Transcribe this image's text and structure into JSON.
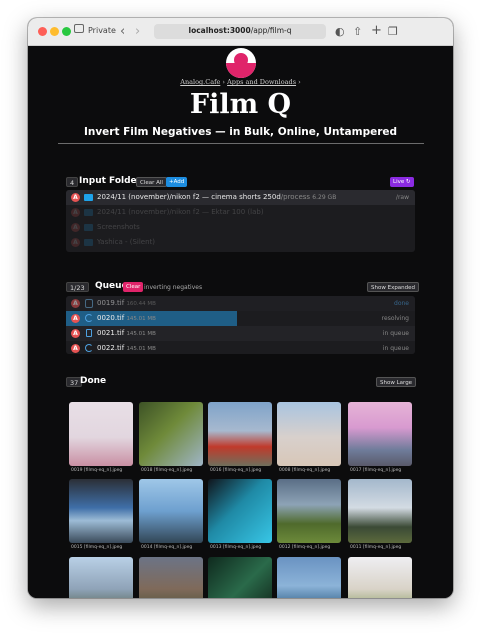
{
  "browser": {
    "private_label": "Private",
    "url_host": "localhost:3000",
    "url_path": "/app/film-q"
  },
  "header": {
    "breadcrumb_home": "Analog.Cafe",
    "breadcrumb_sep": "›",
    "breadcrumb_section": "Apps and Downloads",
    "title": "Film Q",
    "subtitle": "Invert Film Negatives — in Bulk, Online, Untampered"
  },
  "input_folders": {
    "count": "4",
    "title": "Input Folders",
    "clear_all_label": "Clear All",
    "add_label": "+Add",
    "live_label": "Live ↻",
    "rows": [
      {
        "name": "2024/11 (november)/nikon f2 — cinema shorts 250d",
        "path": "/process",
        "size": "6.29 GB",
        "status": "/raw",
        "dim": false
      },
      {
        "name": "2024/11 (november)/nikon f2 — Ektar 100 (lab)",
        "path": "",
        "size": "",
        "status": "",
        "dim": true
      },
      {
        "name": "Screenshots",
        "path": "",
        "size": "",
        "status": "",
        "dim": true
      },
      {
        "name": "Yashica - (Silent)",
        "path": "",
        "size": "",
        "status": "",
        "dim": true
      }
    ]
  },
  "queue": {
    "count": "1/23",
    "title": "Queue",
    "clear_label": "Clear",
    "status": "inverting negatives",
    "show_expanded_label": "Show Expanded",
    "rows": [
      {
        "name": "0019.tif",
        "size": "160.44 MB",
        "status": "done",
        "icon": "check",
        "progress": 0
      },
      {
        "name": "0020.tif",
        "size": "145.01 MB",
        "status": "resolving",
        "icon": "spin",
        "progress": 0.49
      },
      {
        "name": "0021.tif",
        "size": "145.01 MB",
        "status": "in queue",
        "icon": "file",
        "progress": 0
      },
      {
        "name": "0022.tif",
        "size": "145.01 MB",
        "status": "in queue",
        "icon": "spin",
        "progress": 0
      }
    ]
  },
  "done": {
    "count": "37",
    "title": "Done",
    "show_large_label": "Show Large",
    "items": [
      {
        "label": "0019 [filmq-eq_n].jpeg"
      },
      {
        "label": "0018 [filmq-eq_n].jpeg"
      },
      {
        "label": "0016 [filmq-eq_n].jpeg"
      },
      {
        "label": "0008 [filmq-eq_n].jpeg"
      },
      {
        "label": "0017 [filmq-eq_n].jpeg"
      },
      {
        "label": "0015 [filmq-eq_n].jpeg"
      },
      {
        "label": "0014 [filmq-eq_n].jpeg"
      },
      {
        "label": "0013 [filmq-eq_n].jpeg"
      },
      {
        "label": "0012 [filmq-eq_n].jpeg"
      },
      {
        "label": "0011 [filmq-eq_n].jpeg"
      },
      {
        "label": ""
      },
      {
        "label": ""
      },
      {
        "label": ""
      },
      {
        "label": ""
      },
      {
        "label": ""
      }
    ]
  },
  "colors": {
    "brand_pink": "#e0246a",
    "accent_blue": "#1d8de0",
    "live_purple": "#8b2be2",
    "background": "#0c0c0d"
  }
}
